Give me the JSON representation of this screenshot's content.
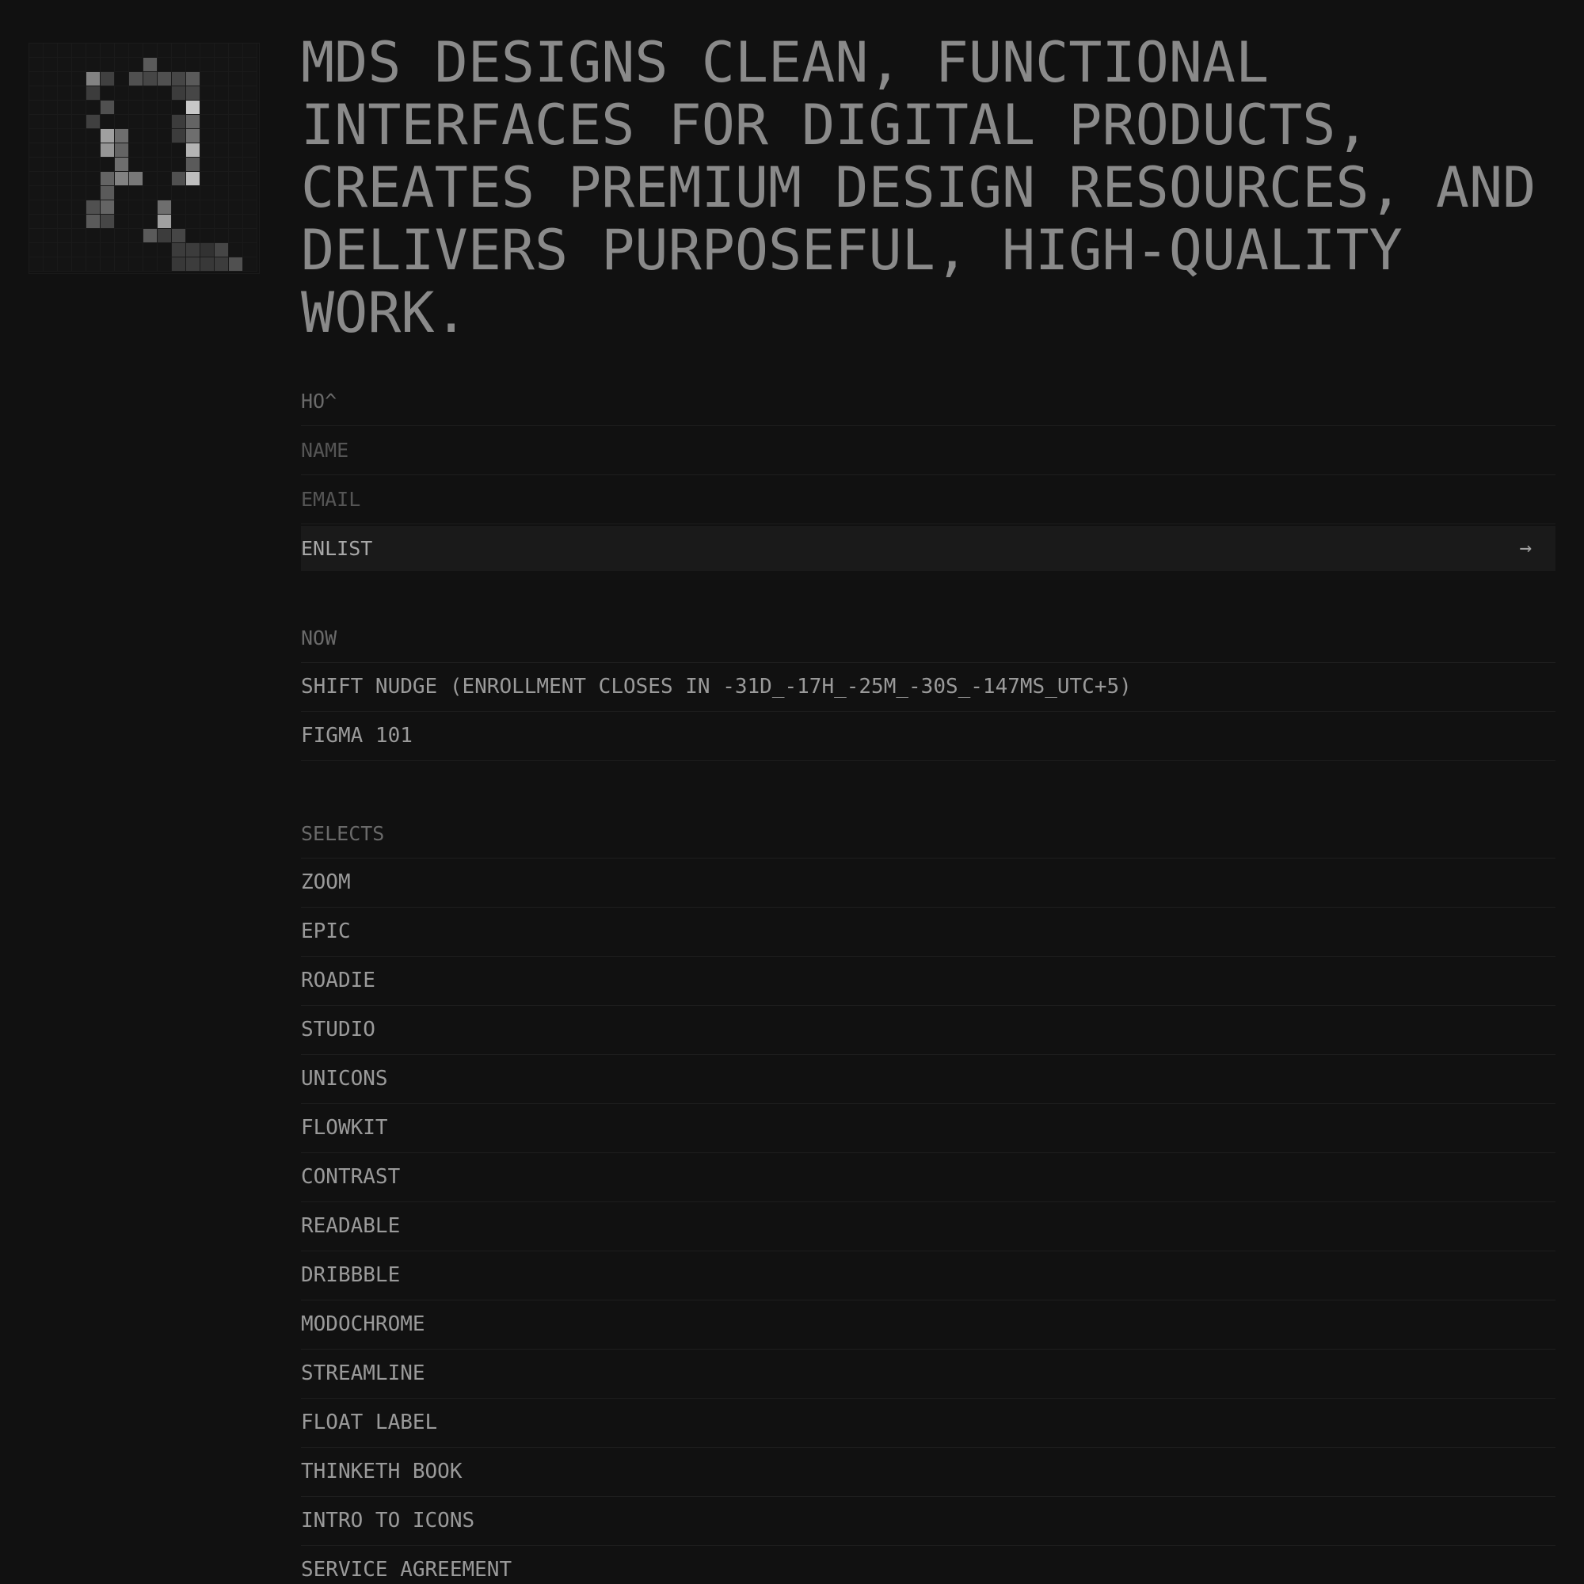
{
  "logo": {
    "name": "pixel-logo",
    "grid_size": 16,
    "lit_cells": [
      {
        "r": 1,
        "c": 8,
        "v": 0.35
      },
      {
        "r": 2,
        "c": 4,
        "v": 0.55
      },
      {
        "r": 2,
        "c": 5,
        "v": 0.22
      },
      {
        "r": 2,
        "c": 7,
        "v": 0.3
      },
      {
        "r": 2,
        "c": 8,
        "v": 0.25
      },
      {
        "r": 2,
        "c": 9,
        "v": 0.3
      },
      {
        "r": 2,
        "c": 10,
        "v": 0.25
      },
      {
        "r": 2,
        "c": 11,
        "v": 0.35
      },
      {
        "r": 3,
        "c": 4,
        "v": 0.2
      },
      {
        "r": 3,
        "c": 10,
        "v": 0.2
      },
      {
        "r": 3,
        "c": 11,
        "v": 0.25
      },
      {
        "r": 4,
        "c": 5,
        "v": 0.3
      },
      {
        "r": 4,
        "c": 11,
        "v": 0.9
      },
      {
        "r": 5,
        "c": 4,
        "v": 0.22
      },
      {
        "r": 5,
        "c": 10,
        "v": 0.2
      },
      {
        "r": 5,
        "c": 11,
        "v": 0.4
      },
      {
        "r": 6,
        "c": 5,
        "v": 0.7
      },
      {
        "r": 6,
        "c": 6,
        "v": 0.45
      },
      {
        "r": 6,
        "c": 10,
        "v": 0.2
      },
      {
        "r": 6,
        "c": 11,
        "v": 0.45
      },
      {
        "r": 7,
        "c": 5,
        "v": 0.65
      },
      {
        "r": 7,
        "c": 6,
        "v": 0.4
      },
      {
        "r": 7,
        "c": 11,
        "v": 0.8
      },
      {
        "r": 8,
        "c": 6,
        "v": 0.45
      },
      {
        "r": 8,
        "c": 11,
        "v": 0.35
      },
      {
        "r": 9,
        "c": 5,
        "v": 0.4
      },
      {
        "r": 9,
        "c": 6,
        "v": 0.55
      },
      {
        "r": 9,
        "c": 7,
        "v": 0.5
      },
      {
        "r": 9,
        "c": 10,
        "v": 0.3
      },
      {
        "r": 9,
        "c": 11,
        "v": 0.85
      },
      {
        "r": 10,
        "c": 5,
        "v": 0.35
      },
      {
        "r": 11,
        "c": 4,
        "v": 0.3
      },
      {
        "r": 11,
        "c": 5,
        "v": 0.4
      },
      {
        "r": 11,
        "c": 9,
        "v": 0.45
      },
      {
        "r": 12,
        "c": 4,
        "v": 0.35
      },
      {
        "r": 12,
        "c": 5,
        "v": 0.25
      },
      {
        "r": 12,
        "c": 9,
        "v": 0.7
      },
      {
        "r": 13,
        "c": 8,
        "v": 0.35
      },
      {
        "r": 13,
        "c": 9,
        "v": 0.2
      },
      {
        "r": 13,
        "c": 10,
        "v": 0.25
      },
      {
        "r": 14,
        "c": 10,
        "v": 0.2
      },
      {
        "r": 14,
        "c": 11,
        "v": 0.2
      },
      {
        "r": 14,
        "c": 12,
        "v": 0.15
      },
      {
        "r": 14,
        "c": 13,
        "v": 0.25
      },
      {
        "r": 15,
        "c": 10,
        "v": 0.18
      },
      {
        "r": 15,
        "c": 11,
        "v": 0.2
      },
      {
        "r": 15,
        "c": 12,
        "v": 0.18
      },
      {
        "r": 15,
        "c": 13,
        "v": 0.2
      },
      {
        "r": 15,
        "c": 14,
        "v": 0.3
      }
    ]
  },
  "headline": "MDS DESIGNS CLEAN, FUNCTIONAL INTERFACES FOR DIGITAL PRODUCTS, CREATES PREMIUM DESIGN RESOURCES, AND DELIVERS PURPOSEFUL, HIGH-QUALITY WORK.",
  "signup": {
    "label": "HO^",
    "name_placeholder": "NAME",
    "email_placeholder": "EMAIL",
    "button_label": "ENLIST",
    "button_icon": "→"
  },
  "now": {
    "label": "NOW",
    "items": [
      "SHIFT NUDGE (ENROLLMENT CLOSES IN -31D_-17H_-25M_-30S_-147MS_UTC+5)",
      "FIGMA 101"
    ]
  },
  "selects": {
    "label": "SELECTS",
    "items": [
      "ZOOM",
      "EPIC",
      "ROADIE",
      "STUDIO",
      "UNICONS",
      "FLOWKIT",
      "CONTRAST",
      "READABLE",
      "DRIBBBLE",
      "MODOCHROME",
      "STREAMLINE",
      "FLOAT LABEL",
      "THINKETH BOOK",
      "INTRO TO ICONS",
      "SERVICE AGREEMENT"
    ]
  },
  "colors": {
    "background": "#111111",
    "text": "#8c8c8c",
    "divider": "#1e1e1e",
    "button_bg": "#1a1a1a"
  }
}
